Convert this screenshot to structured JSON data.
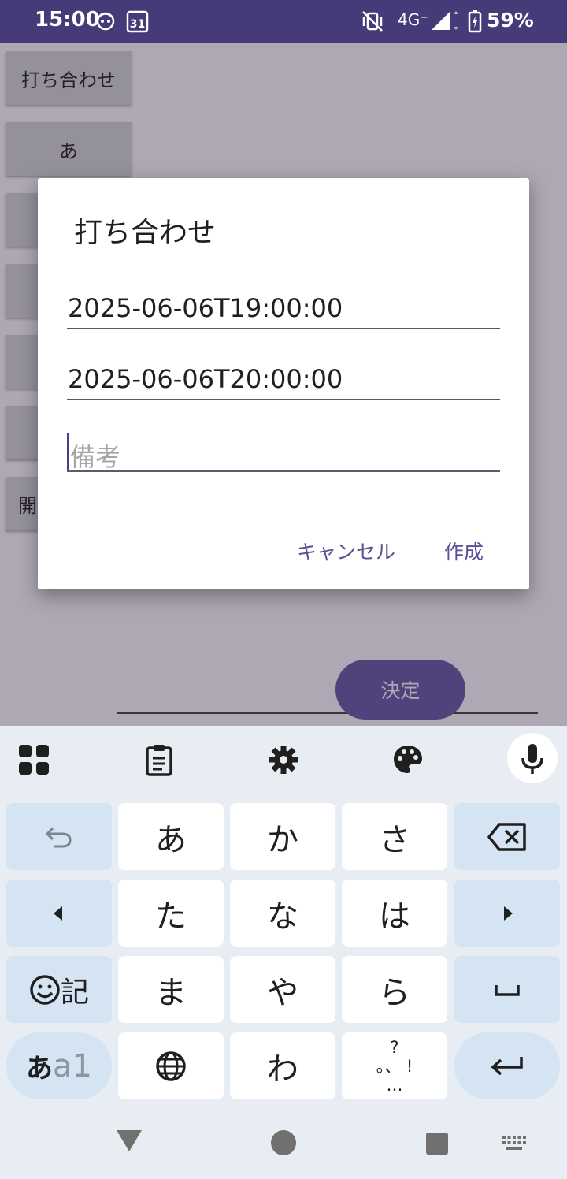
{
  "status_bar": {
    "time": "15:00",
    "calendar_day": "31",
    "network": "4G⁺",
    "battery": "59%"
  },
  "app": {
    "side_buttons": [
      "打ち合わせ",
      "あ",
      "",
      "",
      "",
      "",
      "開"
    ],
    "decide_button": "決定"
  },
  "dialog": {
    "title": "打ち合わせ",
    "start_value": "2025-06-06T19:00:00",
    "end_value": "2025-06-06T20:00:00",
    "note_placeholder": "備考",
    "cancel_label": "キャンセル",
    "create_label": "作成"
  },
  "keyboard": {
    "row1": [
      "あ",
      "か",
      "さ"
    ],
    "row2": [
      "た",
      "な",
      "は"
    ],
    "row3": [
      "ま",
      "や",
      "ら"
    ],
    "row4_middle": "わ",
    "symbol_key": "記",
    "mode_key": {
      "kana": "あ",
      "alpha": "a1"
    },
    "punct_top": "?",
    "punct_mid": "。、 !",
    "punct_bottom": "…"
  },
  "colors": {
    "accent": "#463a78",
    "dialog_button": "#5b4f96",
    "function_key": "#d4e4f2"
  }
}
